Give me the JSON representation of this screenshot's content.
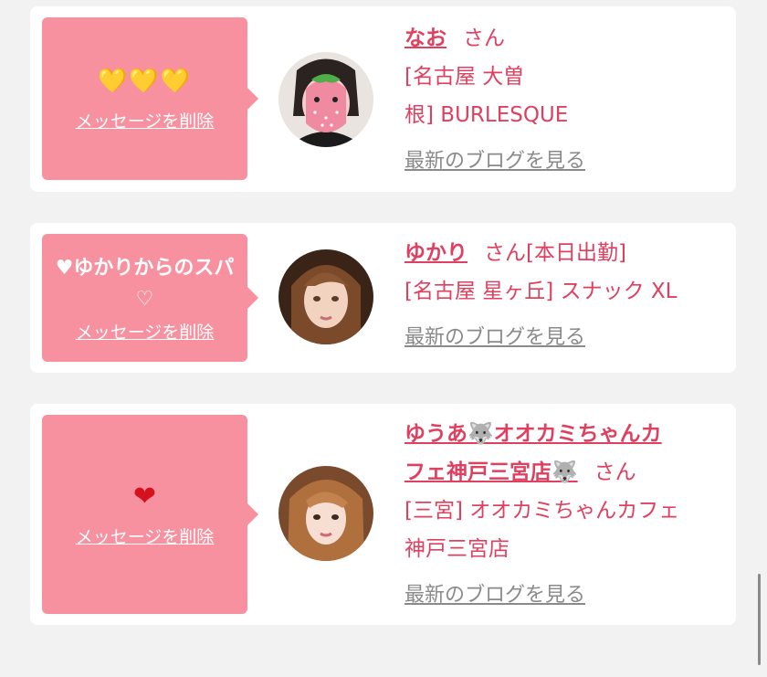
{
  "cards": [
    {
      "message": "",
      "hearts": "💛💛💛",
      "delete_label": "メッセージを削除",
      "name": "なお",
      "honorific": "さん",
      "status": "",
      "shop_lines": [
        "[名古屋 大曽",
        "根] BURLESQUE"
      ],
      "blog_label": "最新のブログを見る"
    },
    {
      "message": "♥ゆかりからのスパ♡",
      "delete_label": "メッセージを削除",
      "name": "ゆかり",
      "honorific": "さん",
      "status": "[本日出勤]",
      "shop_lines": [
        "[名古屋 星ヶ丘] スナック XL"
      ],
      "blog_label": "最新のブログを見る"
    },
    {
      "message": "",
      "hearts": "❤",
      "delete_label": "メッセージを削除",
      "name_lines": [
        "ゆうあ🐺オオカミちゃんカ",
        "フェ神戸三宮店🐺"
      ],
      "honorific": "さん",
      "shop_lines": [
        "[三宮] オオカミちゃんカフェ",
        "神戸三宮店"
      ],
      "blog_label": "最新のブログを見る"
    }
  ],
  "colors": {
    "bubble": "#f7909f",
    "accent": "#e0405f",
    "link_gray": "#8a8a8a"
  }
}
